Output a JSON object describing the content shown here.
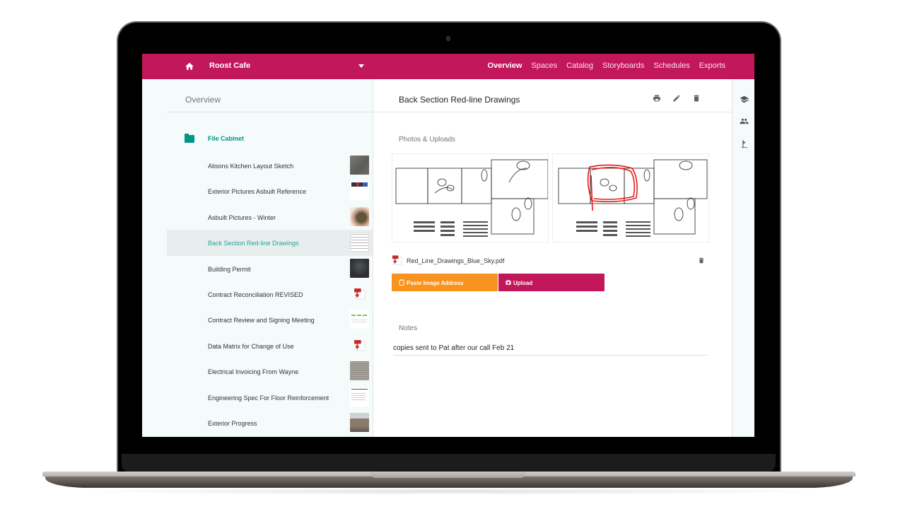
{
  "topbar": {
    "home_icon": "home-icon",
    "project_name": "Roost Cafe",
    "dropdown_icon": "chevron-down-icon",
    "nav": [
      {
        "label": "Overview",
        "active": true
      },
      {
        "label": "Spaces",
        "active": false
      },
      {
        "label": "Catalog",
        "active": false
      },
      {
        "label": "Storyboards",
        "active": false
      },
      {
        "label": "Schedules",
        "active": false
      },
      {
        "label": "Exports",
        "active": false
      }
    ]
  },
  "sidebar": {
    "title": "Overview",
    "folder": {
      "label": "File Cabinet",
      "icon": "folder-icon"
    },
    "items": [
      {
        "label": "Alisons Kitchen Layout Sketch",
        "thumb": "photo"
      },
      {
        "label": "Exterior Pictures Asbuilt Reference",
        "thumb": "photo"
      },
      {
        "label": "Asbuilt Pictures - Winter",
        "thumb": "photo"
      },
      {
        "label": "Back Section Red-line Drawings",
        "thumb": "drawing",
        "selected": true
      },
      {
        "label": "Building Permit",
        "thumb": "photo"
      },
      {
        "label": "Contract Reconciliation REVISED",
        "thumb": "pdf"
      },
      {
        "label": "Contract Review and Signing Meeting",
        "thumb": "document"
      },
      {
        "label": "Data Matrix for Change of Use",
        "thumb": "pdf"
      },
      {
        "label": "Electrical Invoicing From Wayne",
        "thumb": "photo"
      },
      {
        "label": "Engineering Spec For Floor Reinforcement",
        "thumb": "document"
      },
      {
        "label": "Exterior Progress",
        "thumb": "photo"
      }
    ]
  },
  "detail": {
    "title": "Back Section Red-line Drawings",
    "actions": [
      "print-icon",
      "edit-icon",
      "delete-icon"
    ],
    "photos_label": "Photos & Uploads",
    "attachment": {
      "file_name": "Red_Line_Drawings_Blue_Sky.pdf",
      "icon": "pdf-icon"
    },
    "paste_button": "Paste Image Address",
    "upload_button": "Upload",
    "notes_label": "Notes",
    "notes_value": "copies sent to Pat after our call Feb 21"
  },
  "rail": {
    "icons": [
      "school-icon",
      "people-icon",
      "golf-flag-icon"
    ]
  },
  "colors": {
    "brand": "#c2185b",
    "accent": "#009688",
    "paste_button": "#f7931e"
  }
}
